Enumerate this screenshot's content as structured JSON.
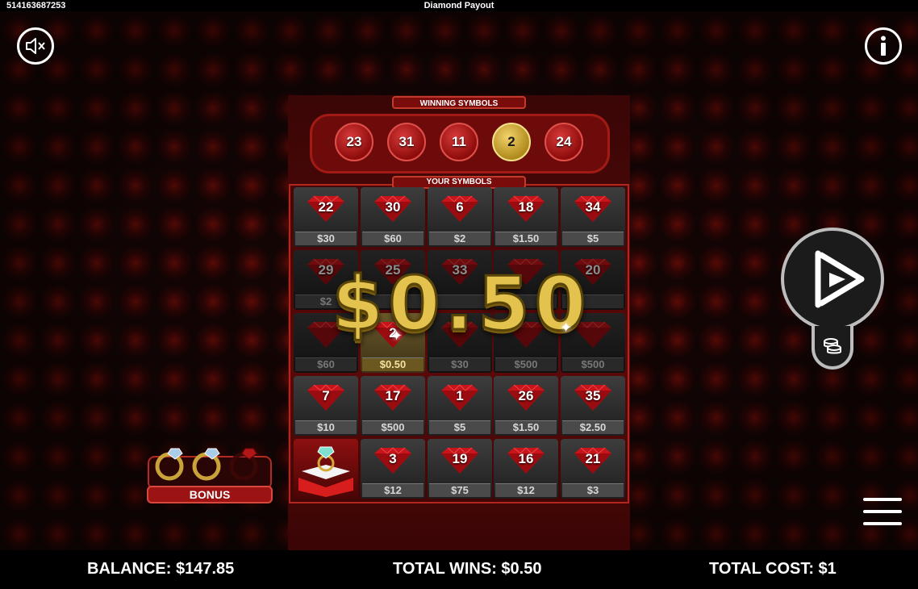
{
  "topbar": {
    "game_id": "514163687253",
    "title": "Diamond Payout"
  },
  "buttons": {
    "mute_icon": "speaker-muted-icon",
    "info_icon": "info-icon",
    "play_icon": "play-icon",
    "coins_icon": "coin-stack-icon",
    "menu_icon": "hamburger-menu-icon"
  },
  "winning": {
    "label": "WINNING SYMBOLS",
    "numbers": [
      "23",
      "31",
      "11",
      "2",
      "24"
    ],
    "matched_index": 3
  },
  "yours": {
    "label": "YOUR SYMBOLS",
    "rows": [
      [
        {
          "num": "22",
          "prize": "$30"
        },
        {
          "num": "30",
          "prize": "$60"
        },
        {
          "num": "6",
          "prize": "$2"
        },
        {
          "num": "18",
          "prize": "$1.50"
        },
        {
          "num": "34",
          "prize": "$5"
        }
      ],
      [
        {
          "num": "29",
          "prize": "$2"
        },
        {
          "num": "25",
          "prize": ""
        },
        {
          "num": "33",
          "prize": ""
        },
        {
          "num": "",
          "prize": ""
        },
        {
          "num": "20",
          "prize": ""
        }
      ],
      [
        {
          "num": "",
          "prize": "$60"
        },
        {
          "num": "2",
          "prize": "$0.50",
          "highlight": true
        },
        {
          "num": "",
          "prize": "$30"
        },
        {
          "num": "",
          "prize": "$500"
        },
        {
          "num": "",
          "prize": "$500"
        }
      ],
      [
        {
          "num": "7",
          "prize": "$10"
        },
        {
          "num": "17",
          "prize": "$500"
        },
        {
          "num": "1",
          "prize": "$5"
        },
        {
          "num": "26",
          "prize": "$1.50"
        },
        {
          "num": "35",
          "prize": "$2.50"
        }
      ],
      [
        {
          "num": "",
          "prize": "",
          "ring": true
        },
        {
          "num": "3",
          "prize": "$12"
        },
        {
          "num": "19",
          "prize": "$75"
        },
        {
          "num": "16",
          "prize": "$12"
        },
        {
          "num": "21",
          "prize": "$3"
        }
      ]
    ]
  },
  "win_amount": "$0.50",
  "bonus": {
    "label": "BONUS",
    "rings_collected": 2,
    "rings_total": 3
  },
  "footer": {
    "balance": "BALANCE: $147.85",
    "total_wins": "TOTAL WINS: $0.50",
    "total_cost": "TOTAL COST: $1"
  },
  "colors": {
    "gem_red": "#c8141a",
    "gold": "#e3c24e",
    "board_red": "#6d0b0b"
  }
}
